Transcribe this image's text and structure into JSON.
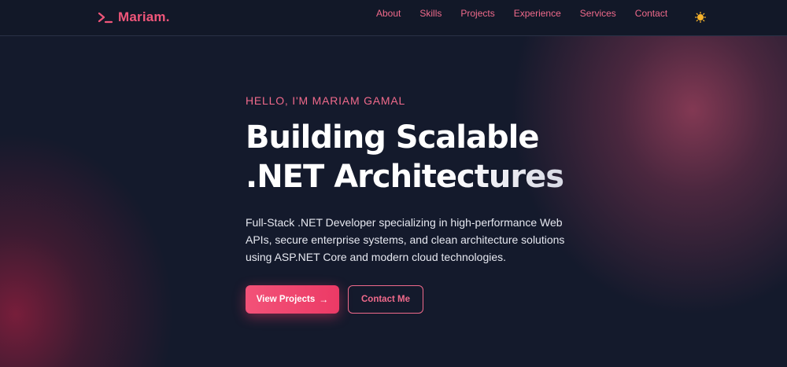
{
  "brand": {
    "prompt_symbol": ">_",
    "name": "Mariam."
  },
  "nav": {
    "items": [
      {
        "label": "About"
      },
      {
        "label": "Skills"
      },
      {
        "label": "Projects"
      },
      {
        "label": "Experience"
      },
      {
        "label": "Services"
      },
      {
        "label": "Contact"
      }
    ],
    "theme_toggle_icon": "sun-icon"
  },
  "hero": {
    "eyebrow": "HELLO, I'M MARIAM GAMAL",
    "headline_line1": "Building Scalable",
    "headline_line2": ".NET Architectures",
    "description": "Full-Stack .NET Developer specializing in high-performance Web APIs, secure enterprise systems, and clean architecture solutions using ASP.NET Core and modern cloud technologies.",
    "primary_button": {
      "label": "View Projects",
      "icon": "arrow-right-icon"
    },
    "secondary_button": {
      "label": "Contact Me"
    }
  },
  "colors": {
    "background": "#141a2c",
    "accent": "#f0567a",
    "accent_button": "#ec3a66",
    "text": "#ffffff"
  }
}
